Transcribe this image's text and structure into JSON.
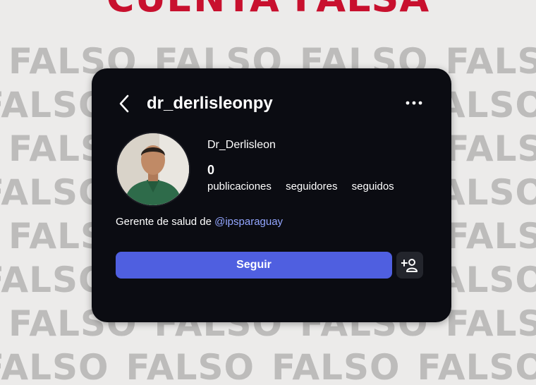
{
  "headline": {
    "text": "CUENTA FALSA",
    "color": "#c8102e"
  },
  "background_watermark": {
    "word": "FALSO",
    "rows": 8,
    "color": "#bdbcbb"
  },
  "profile": {
    "username": "dr_derlisleonpy",
    "display_name": "Dr_Derlisleon",
    "posts_count": "0",
    "labels": {
      "posts": "publicaciones",
      "followers": "seguidores",
      "following": "seguidos"
    },
    "bio": {
      "text": "Gerente de salud de ",
      "mention": "@ipsparaguay"
    }
  },
  "actions": {
    "follow_label": "Seguir",
    "follow_color": "#4f5fe0"
  },
  "icons": {
    "back": "chevron-left-icon",
    "more": "more-horizontal-icon",
    "add_person": "add-person-icon"
  }
}
